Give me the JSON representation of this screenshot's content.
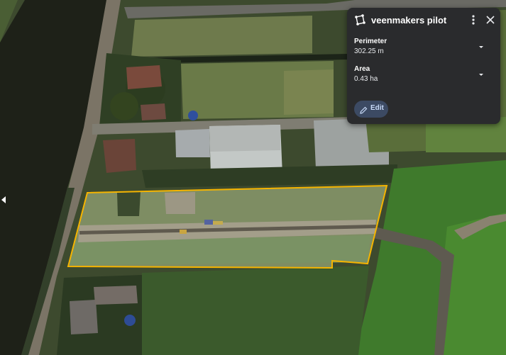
{
  "panel": {
    "title": "veenmakers pilot",
    "title_icon": "polygon-icon",
    "more_icon": "more-vert-icon",
    "close_icon": "close-icon",
    "metrics": [
      {
        "label": "Perimeter",
        "value": "302.25 m"
      },
      {
        "label": "Area",
        "value": "0.43 ha"
      }
    ],
    "edit_label": "Edit",
    "edit_icon": "pencil-icon"
  },
  "map": {
    "type": "satellite",
    "polygon_outline_color": "#f5b400"
  },
  "colors": {
    "panel_bg": "#2a2b2d",
    "edit_button_bg": "#3c4a63",
    "edit_text": "#c8daf8",
    "polygon_outline": "#f5b400"
  }
}
